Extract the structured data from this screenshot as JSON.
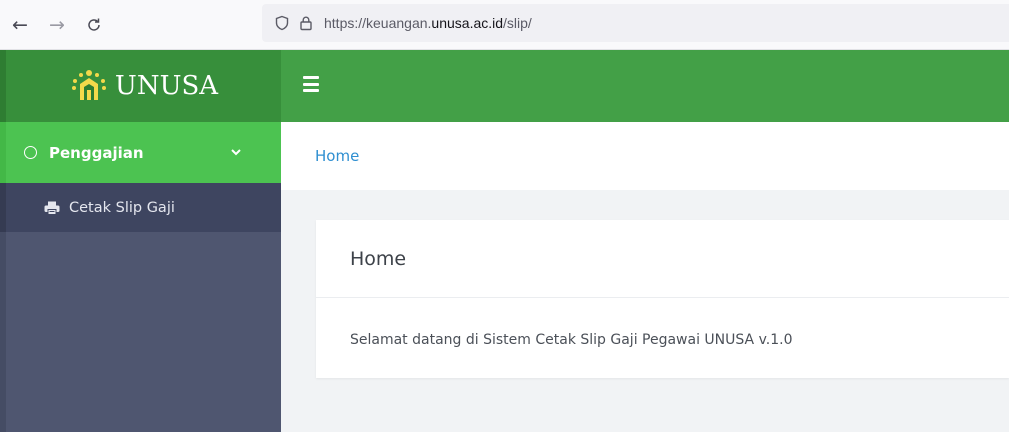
{
  "browser": {
    "url_prefix": "https://keuangan.",
    "url_domain": "unusa.ac.id",
    "url_path": "/slip/",
    "icons": [
      "back-arrow-icon",
      "forward-arrow-icon",
      "reload-icon",
      "shield-icon",
      "lock-icon"
    ]
  },
  "brand": {
    "name": "UNUSA",
    "logo_icon": "unusa-logo-icon"
  },
  "sidebar": {
    "menu": {
      "label": "Penggajian",
      "icon": "circle-icon",
      "expanded": true,
      "items": [
        {
          "label": "Cetak Slip Gaji",
          "icon": "printer-icon"
        }
      ]
    }
  },
  "header": {
    "toggle_icon": "hamburger-icon"
  },
  "breadcrumb": {
    "items": [
      "Home"
    ]
  },
  "card": {
    "title": "Home",
    "body": "Selamat datang di Sistem Cetak Slip Gaji Pegawai UNUSA v.1.0"
  },
  "colors": {
    "header_green": "#43a047",
    "menu_active_green": "#4cc351",
    "sidebar_bg": "#4f5670",
    "link_blue": "#2f8fd1"
  }
}
